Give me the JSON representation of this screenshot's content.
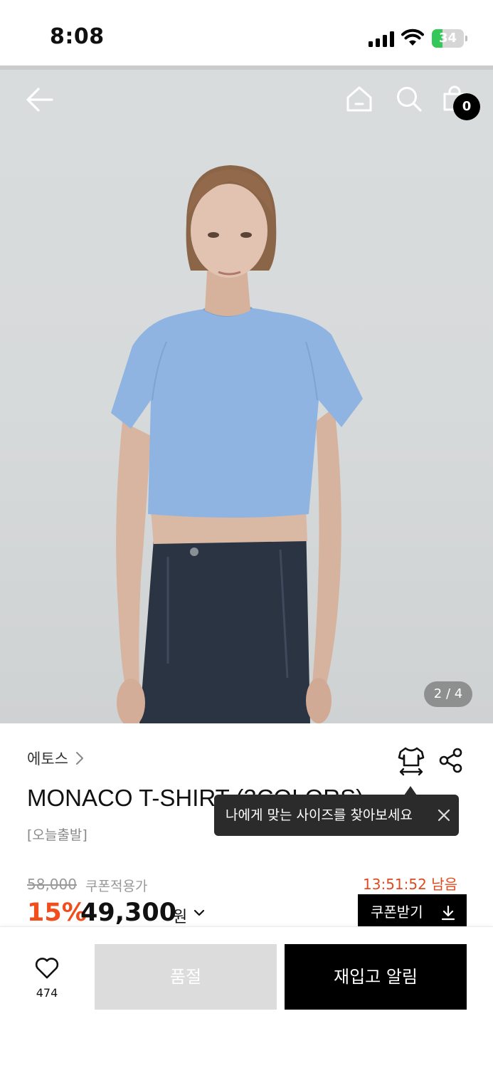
{
  "status_bar": {
    "time": "8:08",
    "battery_level": 34,
    "battery_color": "#34c759"
  },
  "top_nav": {
    "back_icon": "arrow-left-icon",
    "home_icon": "home-icon",
    "search_icon": "search-icon",
    "cart_icon": "shopping-bag-icon",
    "cart_count": "0"
  },
  "gallery": {
    "counter": "2 / 4",
    "current": 2,
    "total": 4
  },
  "product": {
    "brand": "에토스",
    "title": "MONACO T-SHIRT (3COLORS)",
    "shipping_tag": "[오늘출발]",
    "size_icon": "tshirt-size-icon",
    "share_icon": "share-icon"
  },
  "tooltip": {
    "text": "나에게 맞는 사이즈를 찾아보세요",
    "close_icon": "close-icon"
  },
  "pricing": {
    "original_price": "58,000",
    "coupon_note": "쿠폰적용가",
    "timer": "13:51:52 남음",
    "discount": "15%",
    "sale_price": "49,300",
    "currency": "원",
    "discount_color": "#f04e1c",
    "coupon_button": "쿠폰받기",
    "coupon_button_icon": "download-icon"
  },
  "bottom_bar": {
    "like_icon": "heart-icon",
    "like_count": "474",
    "soldout_label": "품절",
    "restock_label": "재입고 알림"
  }
}
